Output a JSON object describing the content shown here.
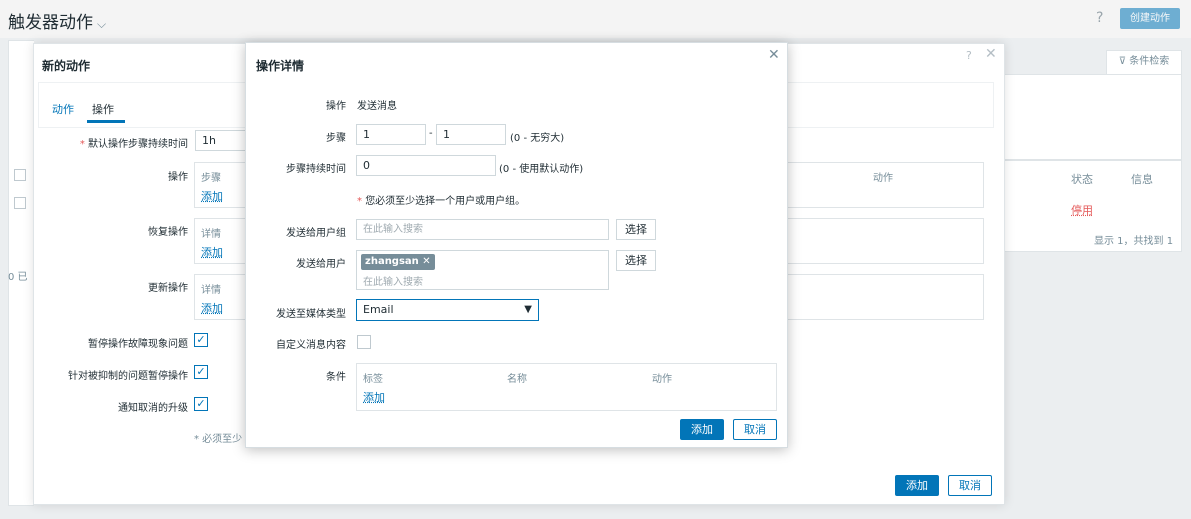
{
  "header": {
    "title": "触发器动作",
    "help": "?",
    "create_button": "创建动作"
  },
  "background": {
    "filter_tab": "条件检索",
    "col_status": "状态",
    "col_info": "信息",
    "row_status": "停用",
    "count_text": "显示 1，共找到 1",
    "left_fragment": "0 已"
  },
  "action_dialog": {
    "title": "新的动作",
    "help": "?",
    "tabs": [
      "动作",
      "操作"
    ],
    "default_step_duration_label": "默认操作步骤持续时间",
    "default_step_duration_value": "1h",
    "operations_label": "操作",
    "recovery_label": "恢复操作",
    "update_label": "更新操作",
    "col_steps": "步骤",
    "col_details": "详情",
    "col_action": "动作",
    "add_link": "添加",
    "pause_symptoms_label": "暂停操作故障现象问题",
    "pause_suppressed_label": "针对被抑制的问题暂停操作",
    "notify_cancel_label": "通知取消的升级",
    "required_note": "* 必须至少",
    "add_button": "添加",
    "cancel_button": "取消"
  },
  "operation_dialog": {
    "title": "操作详情",
    "operation_label": "操作",
    "operation_value": "发送消息",
    "steps_label": "步骤",
    "step_from": "1",
    "step_dash": "-",
    "step_to": "1",
    "steps_hint": "(0 - 无穷大)",
    "step_duration_label": "步骤持续时间",
    "step_duration_value": "0",
    "step_duration_hint": "(0 - 使用默认动作)",
    "warning": "您必须至少选择一个用户或用户组。",
    "send_groups_label": "发送给用户组",
    "search_placeholder": "在此输入搜索",
    "select_button": "选择",
    "send_users_label": "发送给用户",
    "user_tag": "zhangsan",
    "media_type_label": "发送至媒体类型",
    "media_type_value": "Email",
    "custom_message_label": "自定义消息内容",
    "conditions_label": "条件",
    "col_label": "标签",
    "col_name": "名称",
    "col_action": "动作",
    "add_link": "添加",
    "add_button": "添加",
    "cancel_button": "取消"
  }
}
